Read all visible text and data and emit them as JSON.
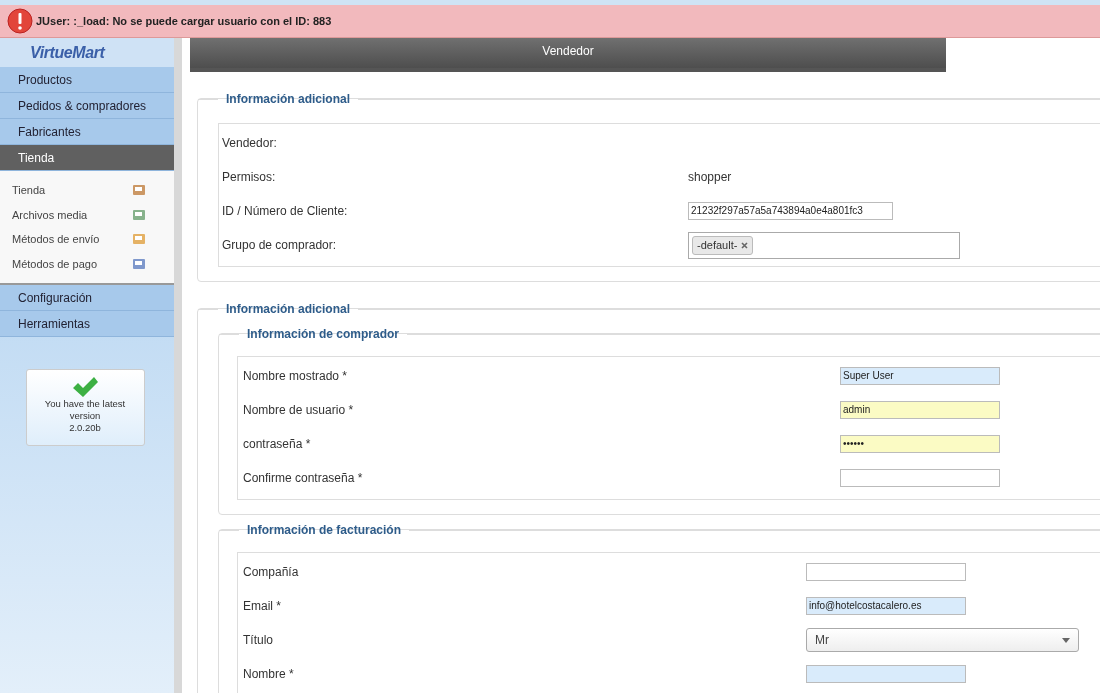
{
  "error": {
    "message": "JUser: :_load: No se puede cargar usuario con el ID: 883"
  },
  "sidebar": {
    "logo": "VirtueMart",
    "items": [
      {
        "label": "Productos",
        "selected": false
      },
      {
        "label": "Pedidos & compradores",
        "selected": false
      },
      {
        "label": "Fabricantes",
        "selected": false
      },
      {
        "label": "Tienda",
        "selected": true,
        "children": [
          {
            "label": "Tienda"
          },
          {
            "label": "Archivos media"
          },
          {
            "label": "Métodos de envío"
          },
          {
            "label": "Métodos de pago"
          }
        ]
      },
      {
        "label": "Configuración",
        "selected": false
      },
      {
        "label": "Herramientas",
        "selected": false
      }
    ],
    "version_box": {
      "text": "You have the latest version",
      "version": "2.0.20b"
    }
  },
  "tab": {
    "label": "Vendedor"
  },
  "sections": [
    {
      "legend": "Información adicional",
      "groups": [
        {
          "fields": [
            {
              "label": "Vendedor:",
              "kind": "text"
            },
            {
              "label": "Permisos:",
              "kind": "text",
              "value": "shopper"
            },
            {
              "label": "ID / Número de Cliente:",
              "kind": "input",
              "value": "21232f297a57a5a743894a0e4a801fc3",
              "color": "#ffffff"
            },
            {
              "label": "Grupo de comprador:",
              "kind": "tags",
              "tags": [
                "-default-"
              ]
            }
          ]
        }
      ]
    },
    {
      "legend": "Información adicional",
      "groups": [
        {
          "legend": "Información de comprador",
          "fields": [
            {
              "label": "Nombre mostrado *",
              "kind": "input",
              "value": "Super User",
              "color": "#d9ebfb"
            },
            {
              "label": "Nombre de usuario *",
              "kind": "input",
              "value": "admin",
              "color": "#fbfbc4"
            },
            {
              "label": "contraseña *",
              "kind": "input",
              "value": "••••••",
              "color": "#fbfbc4"
            },
            {
              "label": "Confirme contraseña *",
              "kind": "input",
              "color": "#ffffff"
            }
          ]
        },
        {
          "legend": "Información de facturación",
          "fields": [
            {
              "label": "Compañía",
              "kind": "input",
              "color": "#ffffff"
            },
            {
              "label": "Email *",
              "kind": "input",
              "value": "info@hotelcostacalero.es",
              "color": "#d9ebfb"
            },
            {
              "label": "Título",
              "kind": "select",
              "value": "Mr"
            },
            {
              "label": "Nombre *",
              "kind": "input",
              "color": "#d9ebfb"
            }
          ]
        }
      ]
    }
  ]
}
